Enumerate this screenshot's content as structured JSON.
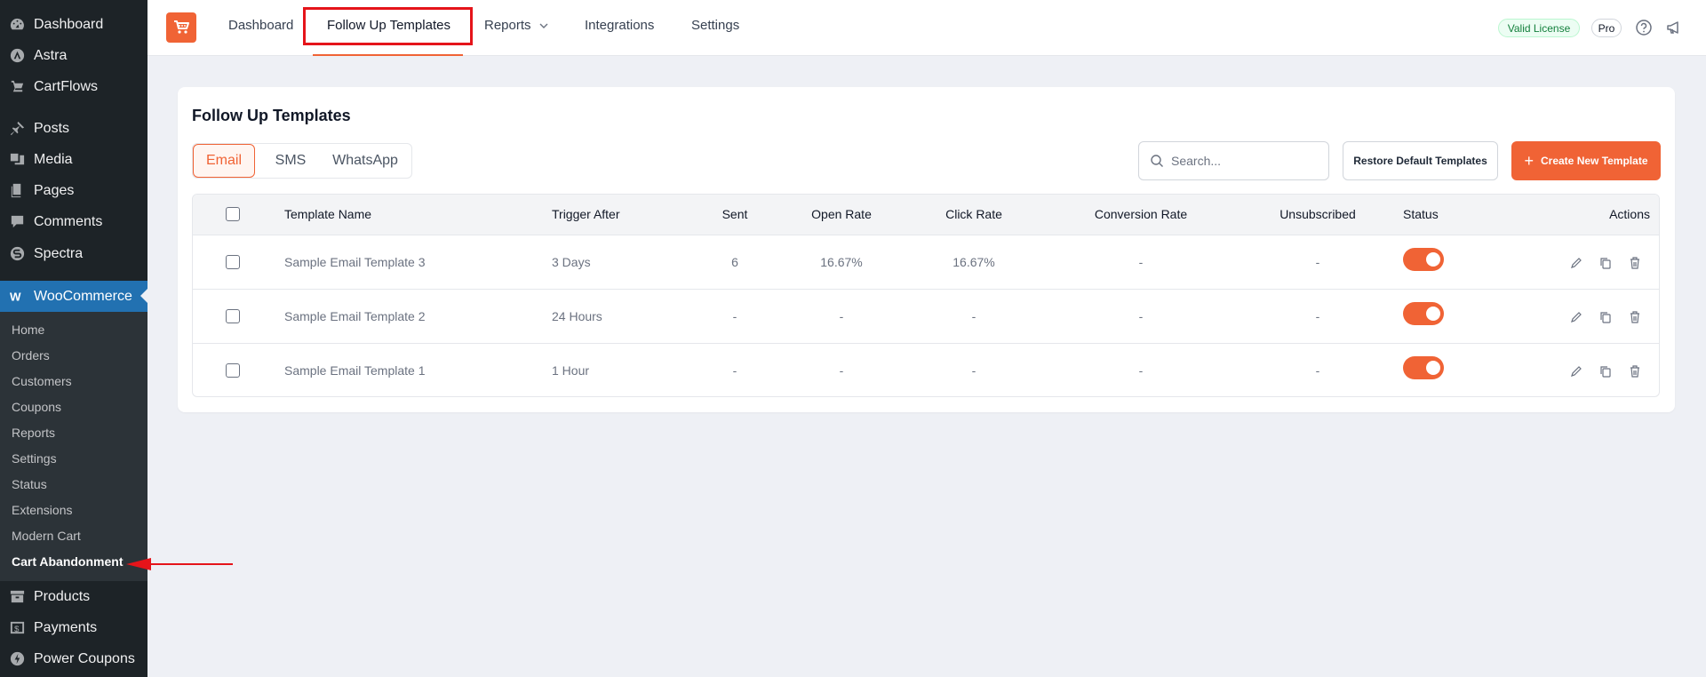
{
  "sidebar": {
    "items": [
      {
        "label": "Dashboard",
        "icon": "dashboard-icon"
      },
      {
        "label": "Astra",
        "icon": "astra-icon"
      },
      {
        "label": "CartFlows",
        "icon": "cartflows-icon"
      },
      {
        "label": "Posts",
        "icon": "pin-icon"
      },
      {
        "label": "Media",
        "icon": "media-icon"
      },
      {
        "label": "Pages",
        "icon": "pages-icon"
      },
      {
        "label": "Comments",
        "icon": "comment-icon"
      },
      {
        "label": "Spectra",
        "icon": "spectra-icon"
      },
      {
        "label": "WooCommerce",
        "icon": "woocommerce-icon"
      },
      {
        "label": "Products",
        "icon": "archive-icon"
      },
      {
        "label": "Payments",
        "icon": "dollar-icon"
      },
      {
        "label": "Power Coupons",
        "icon": "coupon-icon"
      }
    ],
    "submenu": [
      "Home",
      "Orders",
      "Customers",
      "Coupons",
      "Reports",
      "Settings",
      "Status",
      "Extensions",
      "Modern Cart",
      "Cart Abandonment"
    ]
  },
  "topnav": {
    "items": [
      "Dashboard",
      "Follow Up Templates",
      "Reports",
      "Integrations",
      "Settings"
    ],
    "license_badge": "Valid License",
    "plan_badge": "Pro"
  },
  "page": {
    "title": "Follow Up Templates",
    "tabs": [
      "Email",
      "SMS",
      "WhatsApp"
    ],
    "search_placeholder": "Search...",
    "restore_label": "Restore Default Templates",
    "create_label": "Create New Template"
  },
  "table": {
    "columns": [
      "Template Name",
      "Trigger After",
      "Sent",
      "Open Rate",
      "Click Rate",
      "Conversion Rate",
      "Unsubscribed",
      "Status",
      "Actions"
    ],
    "rows": [
      {
        "name": "Sample Email Template 3",
        "trigger": "3 Days",
        "sent": "6",
        "open": "16.67%",
        "click": "16.67%",
        "conversion": "-",
        "unsub": "-",
        "enabled": true
      },
      {
        "name": "Sample Email Template 2",
        "trigger": "24 Hours",
        "sent": "-",
        "open": "-",
        "click": "-",
        "conversion": "-",
        "unsub": "-",
        "enabled": true
      },
      {
        "name": "Sample Email Template 1",
        "trigger": "1 Hour",
        "sent": "-",
        "open": "-",
        "click": "-",
        "conversion": "-",
        "unsub": "-",
        "enabled": true
      }
    ]
  },
  "colors": {
    "accent": "#f06335",
    "sidebar_bg": "#1d2327",
    "sidebar_active": "#2271b1",
    "highlight_box": "#e5141a"
  }
}
